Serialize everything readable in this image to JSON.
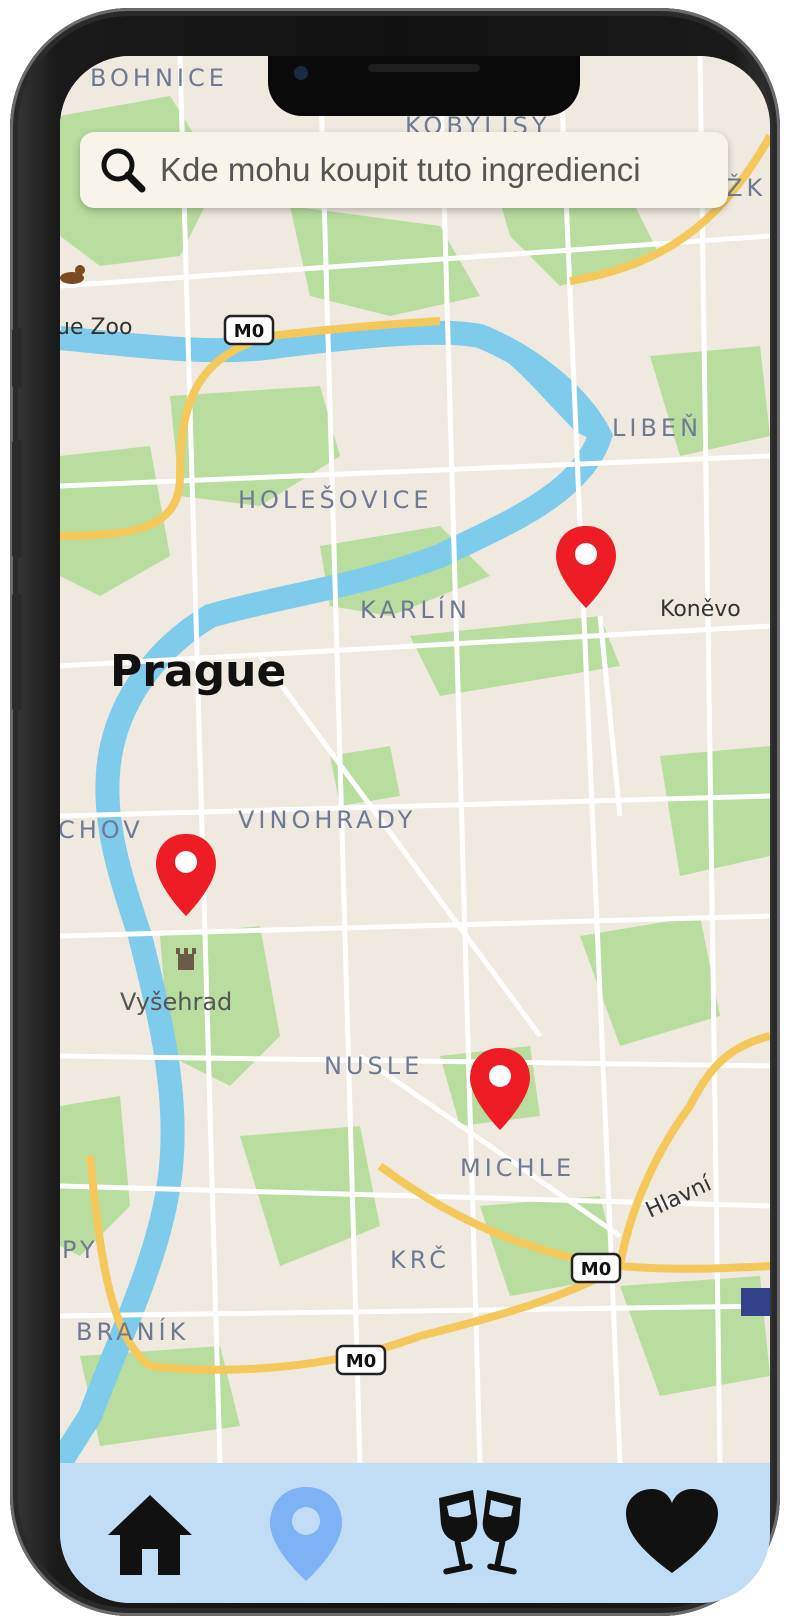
{
  "search": {
    "placeholder": "Kde mohu koupit tuto ingredienci",
    "icon": "search-icon"
  },
  "map": {
    "city_label": "Prague",
    "districts": [
      "BOHNICE",
      "KOBYLISY",
      "HOLEŠOVICE",
      "LIBEŇ",
      "KARLÍN",
      "VINOHRADY",
      "NUSLE",
      "MICHLE",
      "KRČ",
      "BRANÍK",
      "CHOV",
      "Vyšehrad"
    ],
    "places": [
      "ue Zoo",
      "Koněvo",
      "Hlavní"
    ],
    "highway_label": "M0",
    "marker_color": "#ee1c24",
    "marker_count": 3,
    "partial_labels": [
      "PY",
      "ŽK"
    ]
  },
  "nav": {
    "items": [
      {
        "name": "home",
        "icon": "home-icon",
        "active": false
      },
      {
        "name": "map",
        "icon": "map-pin-icon",
        "active": true
      },
      {
        "name": "drinks",
        "icon": "wine-glasses-icon",
        "active": false
      },
      {
        "name": "favorites",
        "icon": "heart-icon",
        "active": false
      }
    ],
    "active_color": "#7fb1f5",
    "background": "#c1dcf5"
  }
}
